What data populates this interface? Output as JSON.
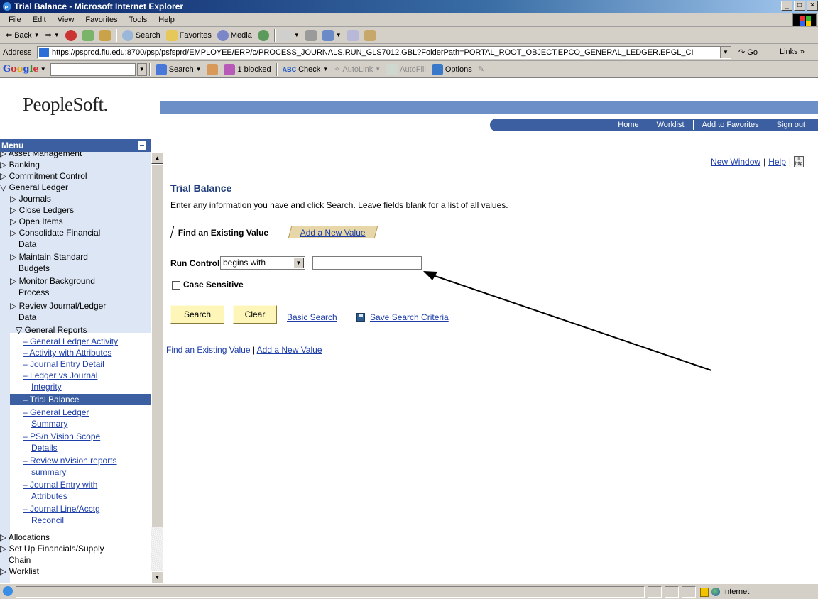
{
  "window": {
    "title": "Trial Balance - Microsoft Internet Explorer",
    "controls": [
      "_",
      "□",
      "×"
    ]
  },
  "menubar": [
    "File",
    "Edit",
    "View",
    "Favorites",
    "Tools",
    "Help"
  ],
  "toolbar": {
    "back": "Back",
    "search": "Search",
    "favorites": "Favorites",
    "media": "Media"
  },
  "addressbar": {
    "label": "Address",
    "url": "https://psprod.fiu.edu:8700/psp/psfsprd/EMPLOYEE/ERP/c/PROCESS_JOURNALS.RUN_GLS7012.GBL?FolderPath=PORTAL_ROOT_OBJECT.EPCO_GENERAL_LEDGER.EPGL_CI",
    "go": "Go",
    "links": "Links"
  },
  "googlebar": {
    "search": "Search",
    "blocked": "1 blocked",
    "check": "Check",
    "autolink": "AutoLink",
    "autofill": "AutoFill",
    "options": "Options"
  },
  "header": {
    "logo": "PeopleSoft.",
    "nav": [
      "Home",
      "Worklist",
      "Add to Favorites",
      "Sign out"
    ]
  },
  "sidebar": {
    "title": "Menu",
    "items": {
      "asset_mgmt": "Asset Management",
      "banking": "Banking",
      "commitment": "Commitment Control",
      "gl": "General Ledger",
      "journals": "Journals",
      "close_ledgers": "Close Ledgers",
      "open_items": "Open Items",
      "consolidate_1": "Consolidate Financial",
      "consolidate_2": "Data",
      "maintain_1": "Maintain Standard",
      "maintain_2": "Budgets",
      "monitor_1": "Monitor Background",
      "monitor_2": "Process",
      "review_1": "Review Journal/Ledger",
      "review_2": "Data",
      "general_reports": "General Reports",
      "gl_activity": "General Ledger Activity",
      "activity_attr": "Activity with Attributes",
      "journal_entry_detail": "Journal Entry Detail",
      "ledger_vs_1": "Ledger vs Journal",
      "ledger_vs_2": "Integrity",
      "trial_balance": "Trial Balance",
      "gl_summary_1": "General Ledger",
      "gl_summary_2": "Summary",
      "psn_1": "PS/n Vision Scope",
      "psn_2": "Details",
      "review_nv_1": "Review nVision reports",
      "review_nv_2": "summary",
      "je_attr_1": "Journal Entry with",
      "je_attr_2": "Attributes",
      "jl_1": "Journal Line/Acctg",
      "jl_2": "Reconcil",
      "allocations": "Allocations",
      "setup_1": "Set Up Financials/Supply",
      "setup_2": "Chain",
      "worklist": "Worklist"
    }
  },
  "main": {
    "top_links": [
      "New Window",
      "Help"
    ],
    "title": "Trial Balance",
    "instructions": "Enter any information you have and click Search. Leave fields blank for a list of all values.",
    "tabs": [
      "Find an Existing Value",
      "Add a New Value"
    ],
    "run_control_label": "Run Control ID:",
    "operator": "begins with",
    "run_control_value": "",
    "case_sensitive": "Case Sensitive",
    "search_btn": "Search",
    "clear_btn": "Clear",
    "basic_search": "Basic Search",
    "save_search": "Save Search Criteria",
    "bottom_links": [
      "Find an Existing Value",
      "Add a New Value"
    ]
  },
  "statusbar": {
    "zone": "Internet"
  }
}
